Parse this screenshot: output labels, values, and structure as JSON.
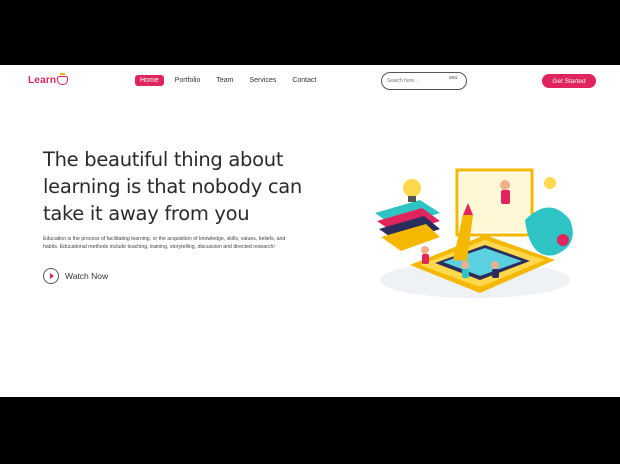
{
  "header": {
    "logo_text": "Learn",
    "nav": [
      {
        "label": "Home",
        "active": true
      },
      {
        "label": "Portfolio",
        "active": false
      },
      {
        "label": "Team",
        "active": false
      },
      {
        "label": "Services",
        "active": false
      },
      {
        "label": "Contact",
        "active": false
      }
    ],
    "search": {
      "placeholder": "Search here..",
      "icon_alt": "sea"
    },
    "cta_label": "Get Started"
  },
  "hero": {
    "title": "The beautiful thing about learning is that nobody can take it away from you",
    "description": "Education is the process of facilitating learning, or the acquisition of knowledge, skills, values, beliefs, and habits. Educational methods include teaching, training, storytelling, discussion and directed research!",
    "watch_label": "Watch Now"
  },
  "colors": {
    "accent": "#e0245e",
    "yellow": "#f5b800",
    "teal": "#2ec4c4",
    "navy": "#2b2d5c"
  }
}
